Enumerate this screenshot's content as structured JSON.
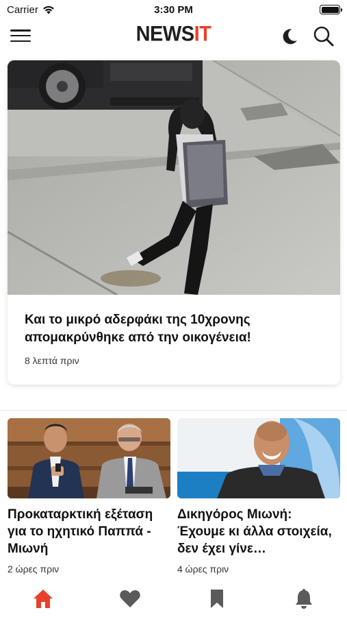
{
  "status_bar": {
    "carrier": "Carrier",
    "time": "3:30 PM",
    "battery_level": 1.0
  },
  "header": {
    "logo_main": "NEWS",
    "logo_accent": "IT",
    "menu_icon": "hamburger-menu-icon",
    "dark_mode_icon": "moon-icon",
    "search_icon": "search-icon"
  },
  "hero_article": {
    "title": "Και το μικρό αδερφάκι της 10χρονης απομακρύνθηκε από την οικογένεια!",
    "time": "8 λεπτά πριν"
  },
  "articles": [
    {
      "title": "Προκαταρκτική εξέταση για το ηχητικό Παππά - Μιωνή",
      "time": "2 ώρες πριν"
    },
    {
      "title": "Δικηγόρος Μιωνή: Έχουμε κι άλλα στοιχεία, δεν έχει γίνε…",
      "time": "4 ώρες πριν"
    }
  ],
  "tab_bar": {
    "active_tab": "home",
    "active_color": "#e8402a",
    "inactive_color": "#5a5a5a",
    "tabs": [
      "home-icon",
      "heart-icon",
      "bookmark-icon",
      "bell-icon"
    ]
  }
}
